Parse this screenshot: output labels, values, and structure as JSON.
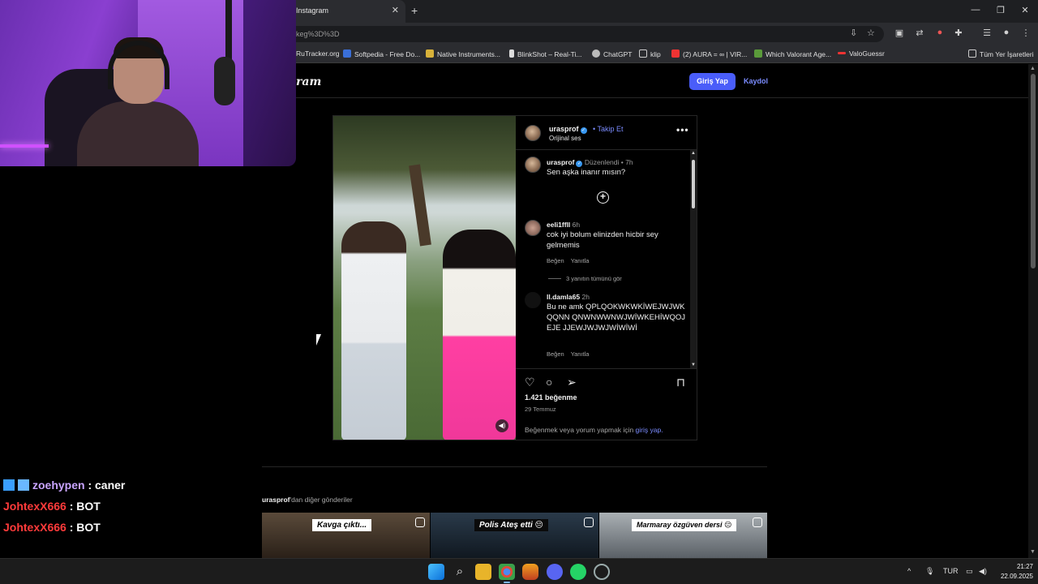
{
  "browser": {
    "tab_title": "Instagram",
    "url": "keg%3D%3D",
    "bookmarks": [
      "RuTracker.org",
      "Softpedia - Free Do...",
      "Native Instruments...",
      "BlinkShot – Real-Ti...",
      "ChatGPT",
      "klip",
      "(2) AURA = ∞ | VIR...",
      "Which Valorant Age...",
      "ValoGuessr"
    ],
    "all_bookmarks": "Tüm Yer İşaretleri"
  },
  "header": {
    "logo": "ram",
    "login_label": "Giriş Yap",
    "signup_label": "Kaydol"
  },
  "post": {
    "username": "urasprof",
    "follow_label": "Takip Et",
    "audio": "Orijinal ses",
    "caption_meta": "Düzenlendi • 7h",
    "caption": "Sen aşka inanır mısın?",
    "comments": [
      {
        "user": "eeli1ffll",
        "time": "6h",
        "text": "cok iyi bolum elinizden hicbir sey gelmemis",
        "like": "Beğen",
        "reply": "Yanıtla"
      },
      {
        "user": "ll.damla65",
        "time": "2h",
        "text": "Bu ne amk QPLQOKWKWKİWEJWJWKQQNN QNWNWWNWJWİWKEHİWQOJEJE JJEWJWJWJWİWİWİ",
        "like": "Beğen",
        "reply": "Yanıtla"
      }
    ],
    "view_replies": "3 yanıtın tümünü gör",
    "likes": "1.421 beğenme",
    "date": "29 Temmuz",
    "login_prompt_text": "Beğenmek veya yorum yapmak için",
    "login_prompt_link": "giriş yap."
  },
  "more_posts": {
    "user": "urasprof",
    "suffix": "'dan diğer gönderiler",
    "thumbnails": [
      "Kavga çıktı...",
      "Polis Ateş etti 😔",
      "Marmaray özgüven dersi 😔"
    ]
  },
  "chat": [
    {
      "user": "zoehypen",
      "message": ": caner",
      "color": "#c9a4ff"
    },
    {
      "user": "JohtexX666",
      "message": ": BOT",
      "color": "#ff3b3b"
    },
    {
      "user": "JohtexX666",
      "message": ": BOT",
      "color": "#ff3b3b"
    }
  ],
  "taskbar": {
    "language": "TUR",
    "time": "21:27",
    "date": "22.09.2025"
  },
  "colors": {
    "accent": "#4a5df9",
    "link": "#7b8cff"
  }
}
